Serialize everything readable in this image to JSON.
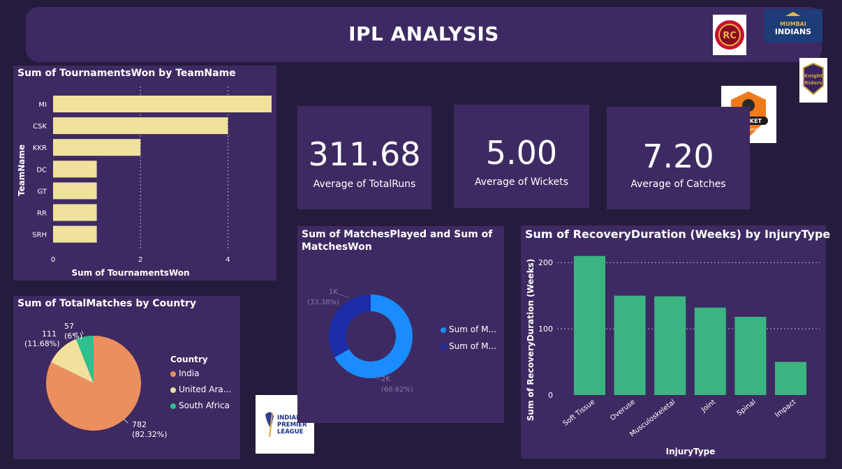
{
  "header": {
    "title": "IPL ANALYSIS"
  },
  "cards": [
    {
      "value": "311.68",
      "label": "Average of TotalRuns"
    },
    {
      "value": "5.00",
      "label": "Average of Wickets"
    },
    {
      "value": "7.20",
      "label": "Average of Catches"
    }
  ],
  "logos": {
    "rcb": "ROYAL CHALLENGERS BANGALORE",
    "mi": "MUMBAI INDIANS",
    "kkr": "Knight Riders",
    "cricket": "CRICKET",
    "cricket_sub": "TOURNAMENT",
    "ipl_line1": "INDIAN",
    "ipl_line2": "PREMIER",
    "ipl_line3": "LEAGUE"
  },
  "colors": {
    "background": "#251c3d",
    "panel": "#3e2a62",
    "bar": "#f0e19c",
    "green": "#3bb482",
    "pie_india": "#ec8f5e",
    "pie_uae": "#f0e19c",
    "pie_sa": "#2ec08f",
    "donut_played": "#1a8cff",
    "donut_won": "#1b2ca8"
  },
  "chart_data": [
    {
      "type": "bar",
      "orientation": "horizontal",
      "title": "Sum of TournamentsWon by TeamName",
      "xlabel": "Sum of TournamentsWon",
      "ylabel": "TeamName",
      "categories": [
        "MI",
        "CSK",
        "KKR",
        "DC",
        "GT",
        "RR",
        "SRH"
      ],
      "values": [
        5,
        4,
        2,
        1,
        1,
        1,
        1
      ],
      "xlim": [
        0,
        5
      ],
      "xticks": [
        "0",
        "2",
        "4"
      ],
      "grid": true
    },
    {
      "type": "pie",
      "title": "Sum of TotalMatches by Country",
      "legend_title": "Country",
      "legend": [
        "India",
        "United Ara...",
        "South Africa"
      ],
      "values": [
        782,
        111,
        57
      ],
      "data_labels": [
        {
          "value": "782",
          "pct": "(82.32%)"
        },
        {
          "value": "111",
          "pct": "(11.68%)"
        },
        {
          "value": "57",
          "pct": "(6%)"
        }
      ]
    },
    {
      "type": "donut",
      "title_line1": "Sum of MatchesPlayed and Sum of",
      "title_line2": "MatchesWon",
      "legend": [
        "Sum of M...",
        "Sum of M..."
      ],
      "percentages": [
        66.62,
        33.38
      ],
      "data_labels": [
        {
          "value": "2K",
          "pct": "(66.62%)"
        },
        {
          "value": "1K",
          "pct": "(33.38%)"
        }
      ]
    },
    {
      "type": "bar",
      "title": "Sum of RecoveryDuration (Weeks) by InjuryType",
      "xlabel": "InjuryType",
      "ylabel": "Sum of RecoveryDuration (Weeks)",
      "categories": [
        "Soft Tissue",
        "Overuse",
        "Musculoskeletal",
        "Joint",
        "Spinal",
        "Impact"
      ],
      "values": [
        210,
        150,
        149,
        132,
        118,
        50
      ],
      "ylim": [
        0,
        235
      ],
      "yticks": [
        "0",
        "100",
        "200"
      ],
      "grid": true
    }
  ]
}
